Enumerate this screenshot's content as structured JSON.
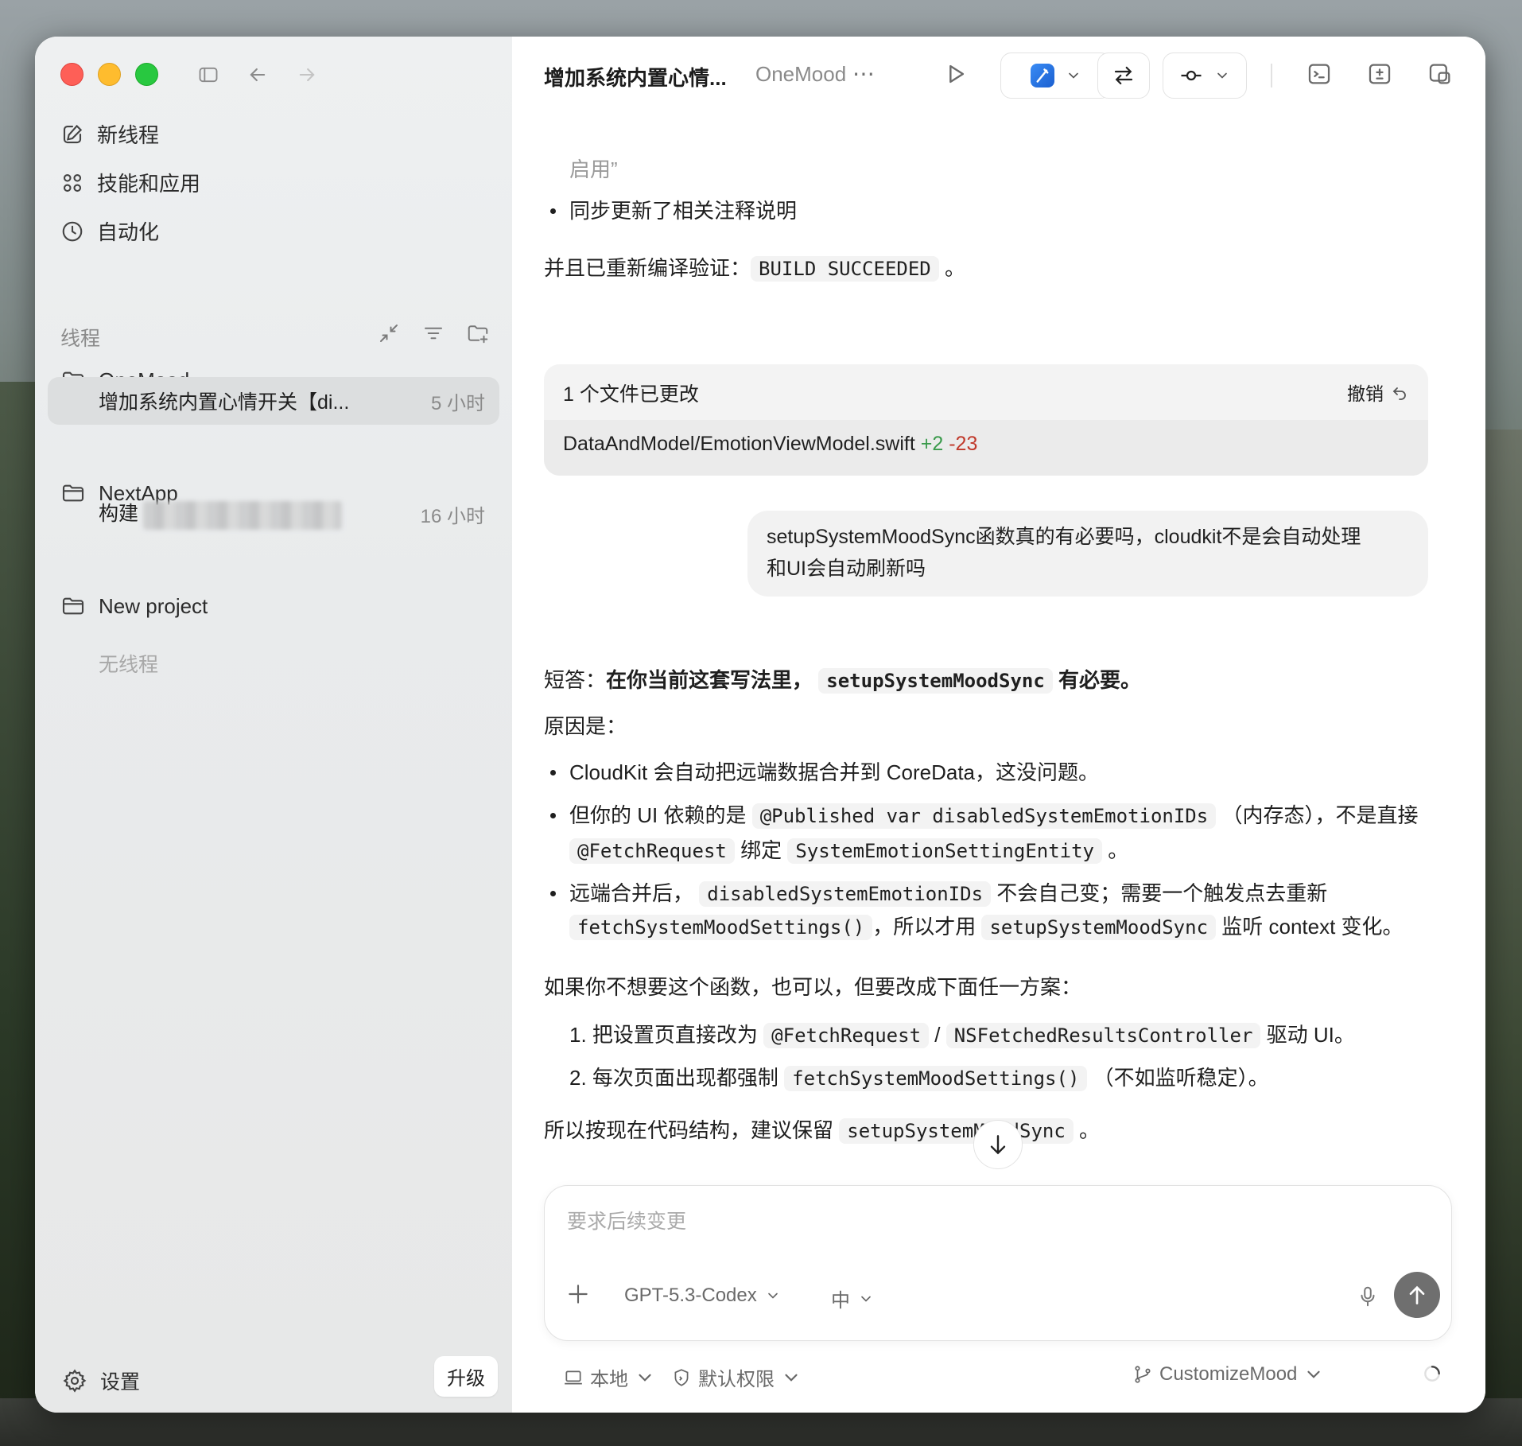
{
  "sidebar": {
    "nav": [
      {
        "label": "新线程",
        "icon": "edit-icon"
      },
      {
        "label": "技能和应用",
        "icon": "grid-icon"
      },
      {
        "label": "自动化",
        "icon": "clock-icon"
      }
    ],
    "section_label": "线程",
    "projects": [
      {
        "name": "OneMood",
        "threads": [
          {
            "title": "增加系统内置心情开关【di...",
            "time": "5 小时",
            "active": true
          }
        ]
      },
      {
        "name": "NextApp",
        "threads": [
          {
            "title": "构建",
            "time": "16 小时",
            "active": false
          }
        ]
      },
      {
        "name": "New project",
        "threads": [],
        "empty_label": "无线程"
      }
    ],
    "settings_label": "设置",
    "upgrade_label": "升级"
  },
  "topbar": {
    "thread_title": "增加系统内置心情...",
    "project": "OneMood",
    "more": "⋯"
  },
  "message": {
    "prev_fragment": "启用”",
    "prev_bullet": "同步更新了相关注释说明",
    "verify_prefix": "并且已重新编译验证：",
    "verify_code": "BUILD SUCCEEDED",
    "verify_suffix": "。"
  },
  "changes_card": {
    "title": "1 个文件已更改",
    "undo_label": "撤销",
    "file": "DataAndModel/EmotionViewModel.swift",
    "additions": "+2",
    "deletions": "-23"
  },
  "user_message": {
    "line1": "setupSystemMoodSync函数真的有必要吗，cloudkit不是会自动处理",
    "line2": "和UI会自动刷新吗"
  },
  "answer": {
    "short_prefix": "短答：",
    "short_bold1": "在你当前这套写法里，",
    "short_code": "setupSystemMoodSync",
    "short_bold2": "有必要。",
    "reason_title": "原因是：",
    "b1": "CloudKit 会自动把远端数据合并到 CoreData，这没问题。",
    "b2_a": "但你的 UI 依赖的是",
    "b2_code1": "@Published var disabledSystemEmotionIDs",
    "b2_b": "（内存态），不是直接",
    "b2_code2": "@FetchRequest",
    "b2_c": "绑定",
    "b2_code3": "SystemEmotionSettingEntity",
    "b2_d": "。",
    "b3_a": "远端合并后，",
    "b3_code1": "disabledSystemEmotionIDs",
    "b3_b": "不会自己变；需要一个触发点去重新",
    "b3_code2": "fetchSystemMoodSettings()",
    "b3_c": "，所以才用",
    "b3_code3": "setupSystemMoodSync",
    "b3_d": "监听 context 变化。",
    "alt_title": "如果你不想要这个函数，也可以，但要改成下面任一方案：",
    "o1_num": "1.",
    "o1_a": "把设置页直接改为",
    "o1_code1": "@FetchRequest",
    "o1_sep": "/",
    "o1_code2": "NSFetchedResultsController",
    "o1_b": "驱动 UI。",
    "o2_num": "2.",
    "o2_a": "每次页面出现都强制",
    "o2_code": "fetchSystemMoodSettings()",
    "o2_b": "（不如监听稳定）。",
    "conclusion_a": "所以按现在代码结构，建议保留",
    "conclusion_code": "setupSystemMoodSync",
    "conclusion_b": "。"
  },
  "composer": {
    "placeholder": "要求后续变更",
    "model": "GPT-5.3-Codex",
    "level": "中"
  },
  "footer": {
    "env": "本地",
    "permission": "默认权限",
    "branch": "CustomizeMood"
  },
  "colors": {
    "additions": "#3a9a4b",
    "deletions": "#c0392b",
    "send_button": "#6f6f6f"
  }
}
